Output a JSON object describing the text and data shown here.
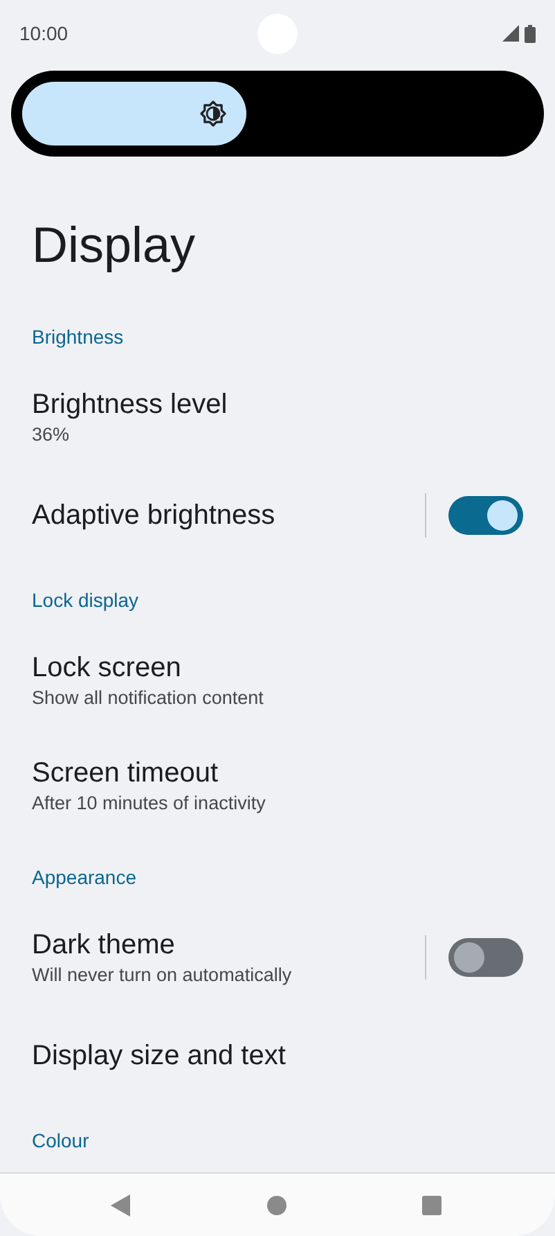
{
  "status_bar": {
    "time": "10:00"
  },
  "brightness_slider": {
    "level": 0.44
  },
  "title": "Display",
  "sections": [
    {
      "header": "Brightness",
      "items": [
        {
          "kind": "text",
          "title": "Brightness level",
          "summary": "36%"
        },
        {
          "kind": "switch",
          "title": "Adaptive brightness",
          "on": true
        }
      ]
    },
    {
      "header": "Lock display",
      "items": [
        {
          "kind": "text",
          "title": "Lock screen",
          "summary": "Show all notification content"
        },
        {
          "kind": "text",
          "title": "Screen timeout",
          "summary": "After 10 minutes of inactivity"
        }
      ]
    },
    {
      "header": "Appearance",
      "items": [
        {
          "kind": "switch",
          "title": "Dark theme",
          "summary": "Will never turn on automatically",
          "on": false
        },
        {
          "kind": "text",
          "title": "Display size and text"
        }
      ]
    },
    {
      "header": "Colour"
    }
  ]
}
